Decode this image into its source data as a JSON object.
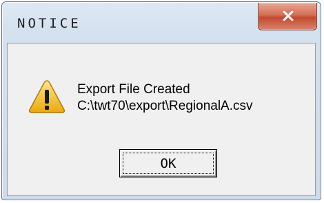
{
  "window": {
    "title": "NOTICE",
    "close_icon": "close-icon"
  },
  "message": {
    "icon": "warning-icon",
    "line1": "Export File Created",
    "line2": "C:\\twt70\\export\\RegionalA.csv"
  },
  "buttons": {
    "ok_label": "OK"
  },
  "colors": {
    "close_button": "#c94f35",
    "warning_fill": "#f5c518",
    "frame": "#d4e1ef"
  }
}
